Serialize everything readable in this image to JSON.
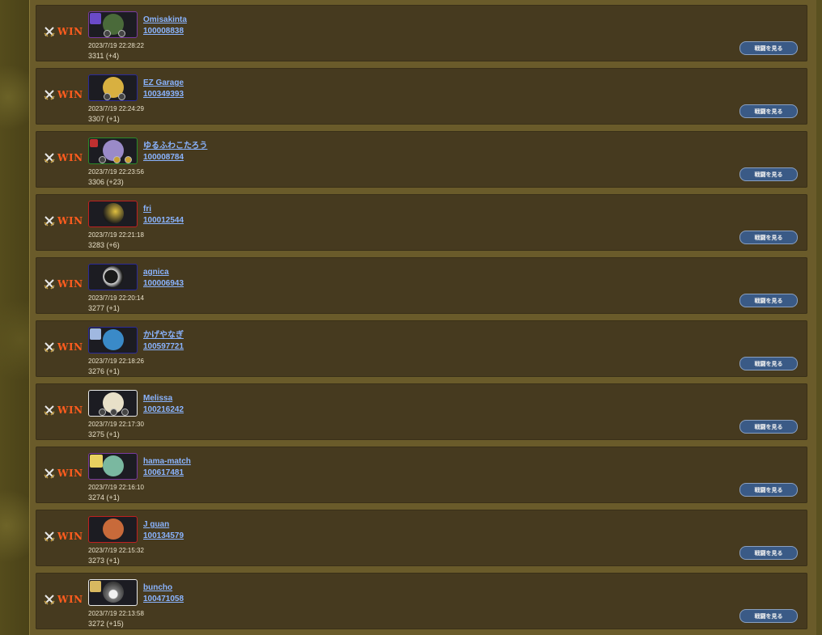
{
  "colors": {
    "win": "#ff5c1e",
    "link": "#8ab4ff",
    "card": "#463a1f",
    "button": "#3a5a86"
  },
  "battles": [
    {
      "result": "WIN",
      "name": "Omisakinta",
      "id": "100008838",
      "datetime": "2023/7/19 22:28:22",
      "score": "3311 (+4)",
      "button": "戦闘を見る",
      "avatar": {
        "border": "#7a3aa0",
        "face": "#4a6a3a",
        "corner": "#6a4ac8"
      }
    },
    {
      "result": "WIN",
      "name": "EZ Garage",
      "id": "100349393",
      "datetime": "2023/7/19 22:24:29",
      "score": "3307 (+1)",
      "button": "戦闘を見る",
      "avatar": {
        "border": "#2a2a9a",
        "face": "#d8b040",
        "corner": ""
      }
    },
    {
      "result": "WIN",
      "name": "ゆるふわこたろう",
      "id": "100008784",
      "datetime": "2023/7/19 22:23:56",
      "score": "3306 (+23)",
      "button": "戦闘を見る",
      "avatar": {
        "border": "#2a8a2a",
        "face": "#9a8ac8",
        "corner": "#c03030"
      }
    },
    {
      "result": "WIN",
      "name": "fri",
      "id": "100012544",
      "datetime": "2023/7/19 22:21:18",
      "score": "3283 (+6)",
      "button": "戦闘を見る",
      "avatar": {
        "border": "#c02020",
        "face": "#e0c040",
        "corner": ""
      }
    },
    {
      "result": "WIN",
      "name": "agnica",
      "id": "100006943",
      "datetime": "2023/7/19 22:20:14",
      "score": "3277 (+1)",
      "button": "戦闘を見る",
      "avatar": {
        "border": "#2a2a9a",
        "face": "#d8d8d8",
        "corner": ""
      }
    },
    {
      "result": "WIN",
      "name": "かげやなぎ",
      "id": "100597721",
      "datetime": "2023/7/19 22:18:26",
      "score": "3276 (+1)",
      "button": "戦闘を見る",
      "avatar": {
        "border": "#2a2a9a",
        "face": "#3a8ac8",
        "corner": "#a0b8e0"
      }
    },
    {
      "result": "WIN",
      "name": "Melissa",
      "id": "100216242",
      "datetime": "2023/7/19 22:17:30",
      "score": "3275 (+1)",
      "button": "戦闘を見る",
      "avatar": {
        "border": "#e8e8e8",
        "face": "#e8e0c8",
        "corner": ""
      }
    },
    {
      "result": "WIN",
      "name": "hama-match",
      "id": "100617481",
      "datetime": "2023/7/19 22:16:10",
      "score": "3274 (+1)",
      "button": "戦闘を見る",
      "avatar": {
        "border": "#7a3aa0",
        "face": "#7ab8a0",
        "corner": "#e8d060"
      }
    },
    {
      "result": "WIN",
      "name": "J guan",
      "id": "100134579",
      "datetime": "2023/7/19 22:15:32",
      "score": "3273 (+1)",
      "button": "戦闘を見る",
      "avatar": {
        "border": "#c02020",
        "face": "#c86a3a",
        "corner": ""
      }
    },
    {
      "result": "WIN",
      "name": "buncho",
      "id": "100471058",
      "datetime": "2023/7/19 22:13:58",
      "score": "3272 (+15)",
      "button": "戦闘を見る",
      "avatar": {
        "border": "#e8e8e8",
        "face": "#7a7a7a",
        "corner": "#d8b860"
      }
    }
  ]
}
